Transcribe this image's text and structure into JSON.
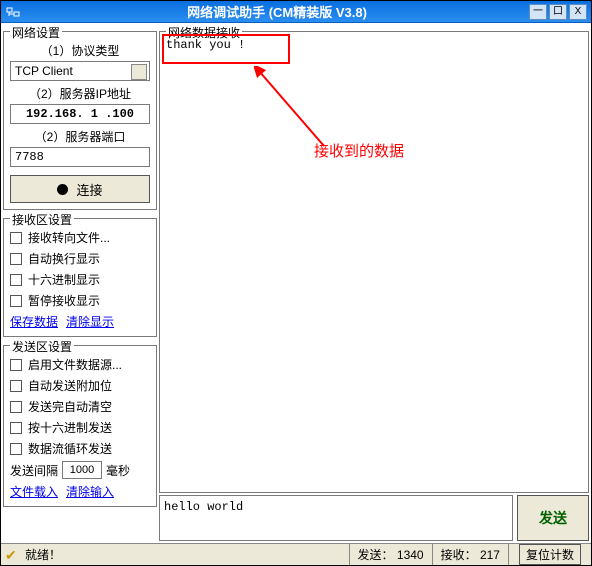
{
  "titlebar": {
    "title": "网络调试助手  (CM精装版 V3.8)"
  },
  "network": {
    "group_title": "网络设置",
    "protocol_label": "（1）协议类型",
    "protocol_value": "TCP Client",
    "server_ip_label": "（2）服务器IP地址",
    "server_ip_value": "192.168. 1 .100",
    "server_port_label": "（2）服务器端口",
    "server_port_value": "7788",
    "connect_label": "连接"
  },
  "recv_settings": {
    "group_title": "接收区设置",
    "items": [
      "接收转向文件...",
      "自动换行显示",
      "十六进制显示",
      "暂停接收显示"
    ],
    "save_link": "保存数据",
    "clear_link": "清除显示"
  },
  "send_settings": {
    "group_title": "发送区设置",
    "items": [
      "启用文件数据源...",
      "自动发送附加位",
      "发送完自动清空",
      "按十六进制发送",
      "数据流循环发送"
    ],
    "interval_label": "发送间隔",
    "interval_value": "1000",
    "interval_unit": "毫秒",
    "load_link": "文件载入",
    "clear_link": "清除输入"
  },
  "recv_area": {
    "group_title": "网络数据接收",
    "content": "thank you !"
  },
  "annotation": {
    "text": "接收到的数据"
  },
  "send_area": {
    "content": "hello world",
    "send_label": "发送"
  },
  "statusbar": {
    "ready": "就绪！",
    "sent_label": "发送：",
    "sent_value": "1340",
    "recv_label": "接收：",
    "recv_value": "217",
    "reset_label": "复位计数"
  }
}
